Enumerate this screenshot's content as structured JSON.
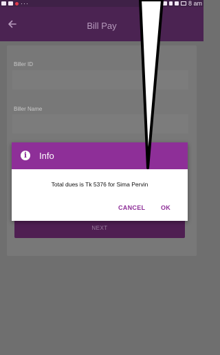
{
  "status_bar": {
    "left_icons": [
      "gallery-icon",
      "image-icon",
      "notification-dot-icon"
    ],
    "overflow": "···",
    "right_icons": [
      "sim-icon",
      "network-icon",
      "signal-icon",
      "battery-icon"
    ],
    "time": "8 am"
  },
  "app_bar": {
    "back_icon": "arrow-back-icon",
    "title": "Bill Pay"
  },
  "form": {
    "biller_id_label": "Biller ID",
    "biller_name_label": "Biller Name",
    "next_label": "NEXT"
  },
  "dialog": {
    "icon": "info-icon",
    "title": "Info",
    "message": "Total dues is Tk 5376 for Sima Pervin",
    "cancel_label": "CANCEL",
    "ok_label": "OK"
  },
  "colors": {
    "accent": "#8e2f98",
    "app_bar": "#4b2352",
    "status_bar": "#3f2147",
    "scrim": "#6f6f6f"
  }
}
